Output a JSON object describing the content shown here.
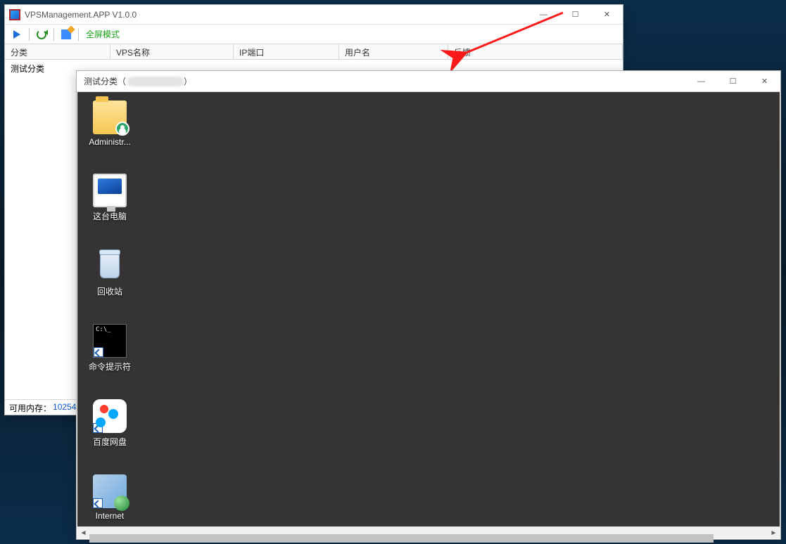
{
  "vps_window": {
    "title": "VPSManagement.APP V1.0.0",
    "win_controls": {
      "min": "—",
      "max": "☐",
      "close": "✕"
    },
    "toolbar": {
      "fullscreen_label": "全屏模式"
    },
    "columns": {
      "category": "分类",
      "vps_name": "VPS名称",
      "ip_port": "IP端口",
      "user": "用户名",
      "feedback": "反馈"
    },
    "sidebar": {
      "test_category": "测试分类"
    },
    "status": {
      "mem_label": "可用内存：",
      "mem_value": "10254"
    }
  },
  "rdp_window": {
    "title_prefix": "测试分类（",
    "title_suffix": "）",
    "win_controls": {
      "min": "—",
      "max": "☐",
      "close": "✕"
    },
    "icons": {
      "administrator": "Administr...",
      "this_pc": "这台电脑",
      "recycle": "回收站",
      "cmd": "命令提示符",
      "baidu": "百度网盘",
      "iis": "Internet"
    }
  }
}
